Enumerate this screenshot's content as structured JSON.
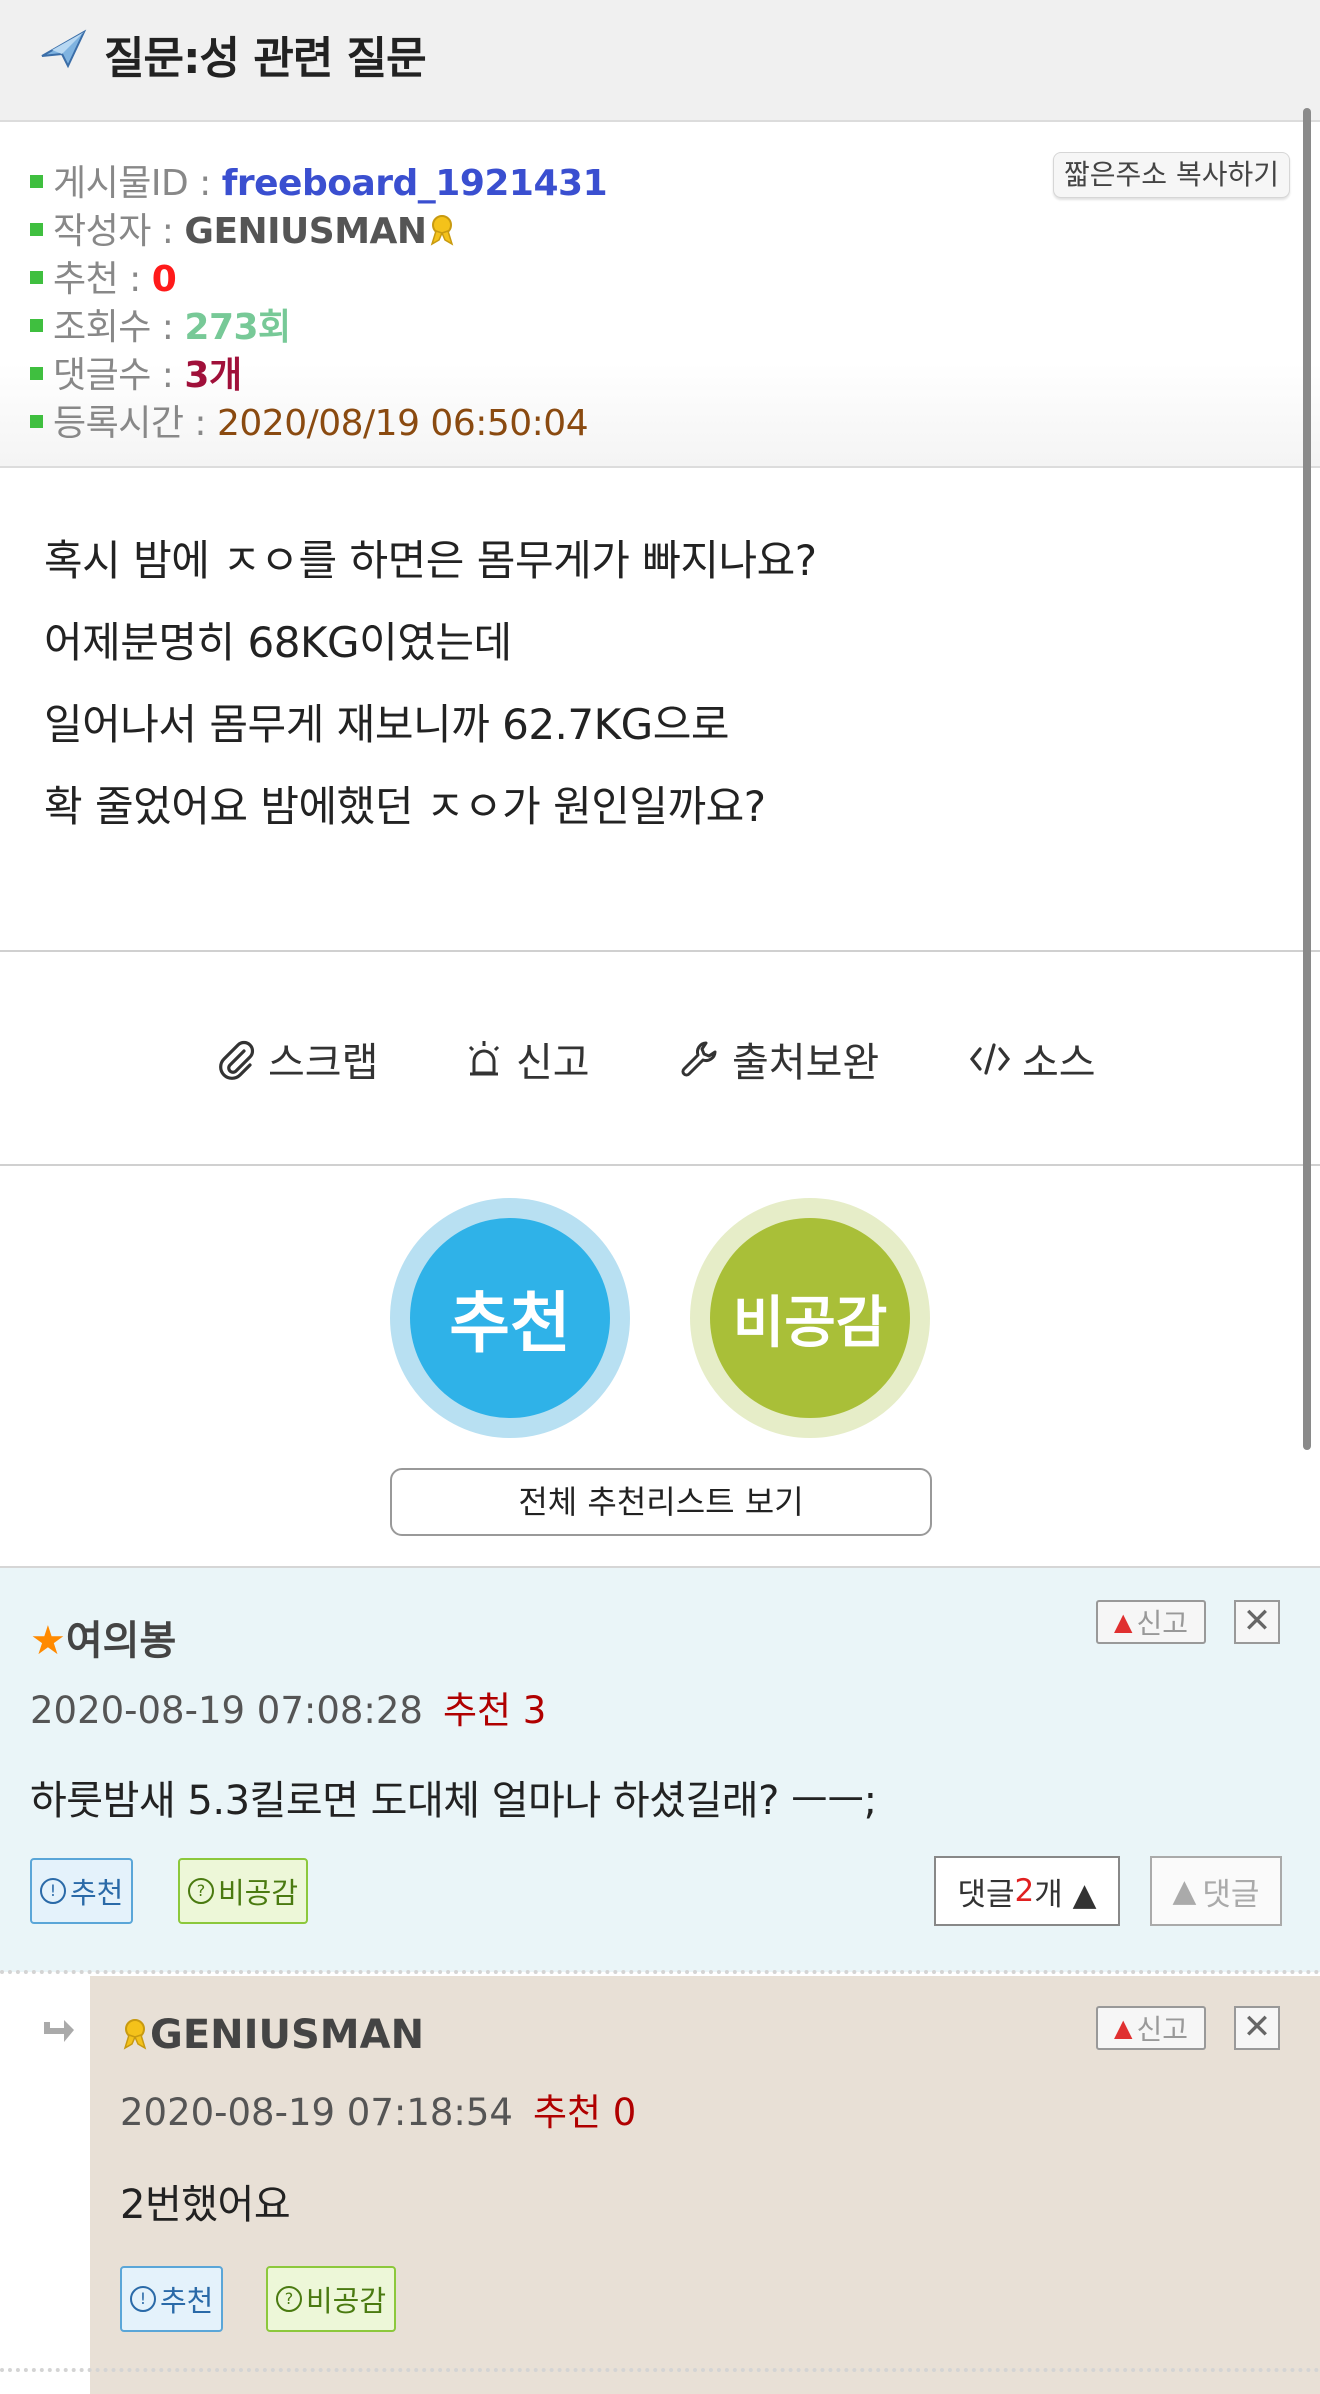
{
  "header": {
    "title": "질문:성 관련 질문",
    "icon": "airplane-icon"
  },
  "meta": {
    "id_label": "게시물ID : ",
    "id_value": "freeboard_1921431",
    "author_label": "작성자 : ",
    "author_value": "GENIUSMAN",
    "rec_label": "추천 : ",
    "rec_value": "0",
    "views_label": "조회수 : ",
    "views_value": "273회",
    "comments_label": "댓글수 : ",
    "comments_value": "3개",
    "time_label": "등록시간 : ",
    "time_value": "2020/08/19 06:50:04",
    "copy_button": "짧은주소 복사하기"
  },
  "post": {
    "lines": [
      "혹시 밤에 ㅈㅇ를 하면은 몸무게가 빠지나요?",
      "어제분명히 68KG이였는데",
      "일어나서 몸무게 재보니까 62.7KG으로",
      "확 줄었어요 밤에했던 ㅈㅇ가 원인일까요?"
    ]
  },
  "actions": {
    "scrap": "스크랩",
    "report": "신고",
    "source_fix": "출처보완",
    "source": "소스"
  },
  "vote": {
    "recommend": "추천",
    "disagree": "비공감",
    "list_button": "전체 추천리스트 보기"
  },
  "comments": [
    {
      "star": "★",
      "author": "여의봉",
      "date": "2020-08-19 07:08:28",
      "rec": "추천 3",
      "text": "하룻밤새 5.3킬로면 도대체 얼마나 하셨길래? ㅡㅡ;",
      "btn_rec": "추천",
      "btn_dis": "비공감",
      "report": "신고",
      "close": "✕",
      "reply_count_prefix": "댓글 ",
      "reply_count_num": "2",
      "reply_count_suffix": "개 ▲",
      "reply_btn": "댓글"
    },
    {
      "author": "GENIUSMAN",
      "date": "2020-08-19 07:18:54",
      "rec": "추천 0",
      "text": "2번했어요",
      "btn_rec": "추천",
      "btn_dis": "비공감",
      "report": "신고",
      "close": "✕"
    }
  ],
  "colors": {
    "recommend_circle": "#2fb2e8",
    "disagree_circle": "#a9bf38",
    "post_id": "#3a4fd0",
    "rec_zero": "#ff1a1a"
  }
}
